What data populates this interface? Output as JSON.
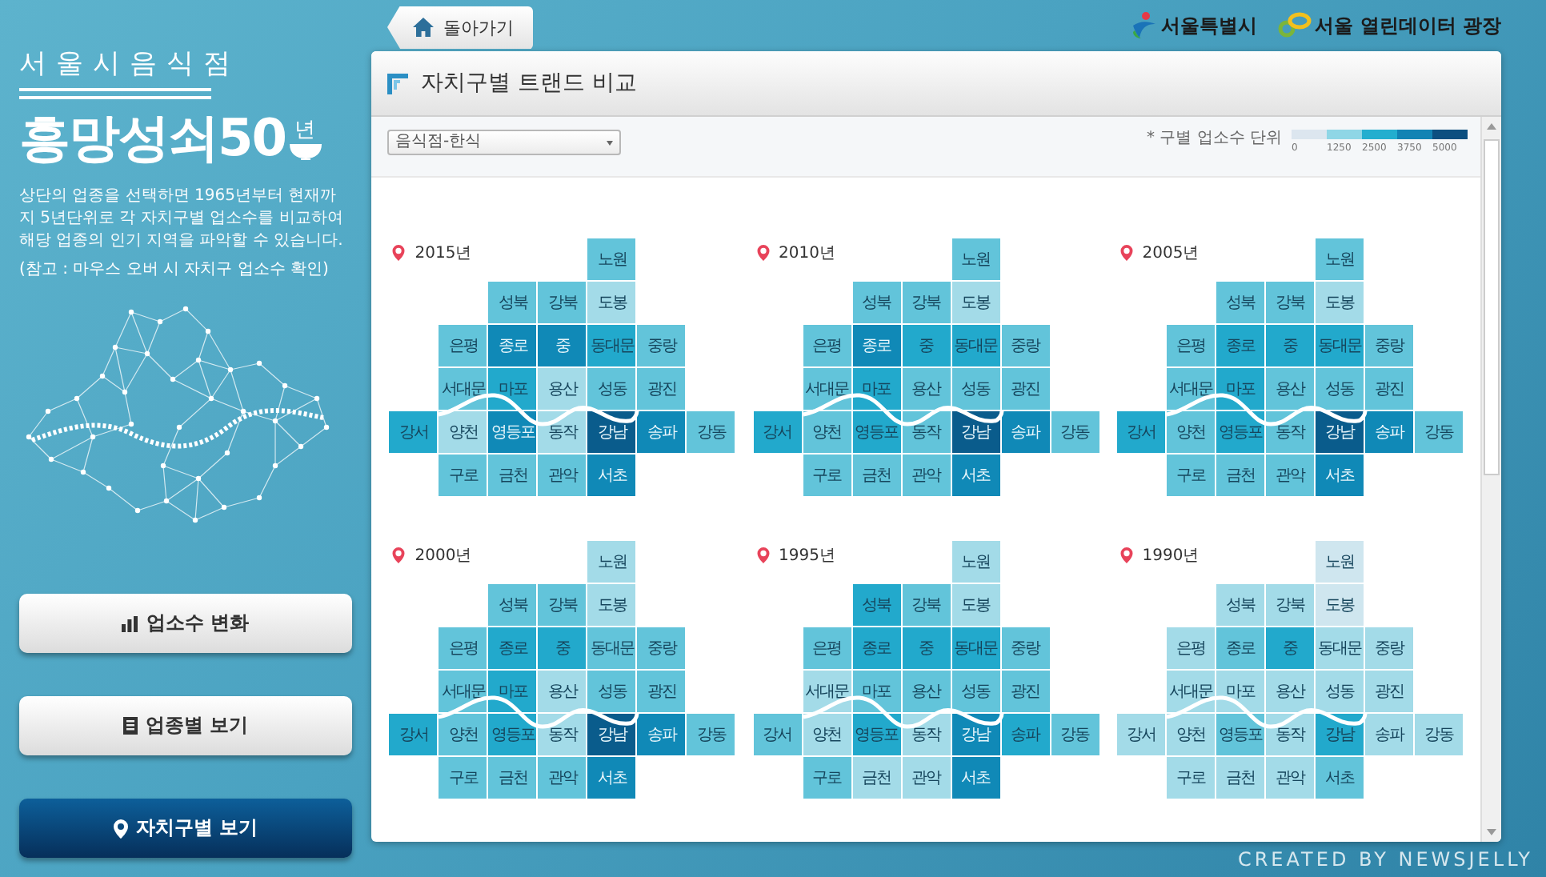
{
  "header": {
    "back_button": "돌아가기",
    "logos": [
      "서울특별시",
      "서울 열린데이터 광장"
    ]
  },
  "sidebar": {
    "subtitle": "서울시음식점",
    "title": "흥망성쇠50",
    "title_unit": "년",
    "description": "상단의 업종을 선택하면 1965년부터 현재까지 5년단위로 각 자치구별 업소수를 비교하여 해당 업종의 인기 지역을 파악할 수 있습니다.",
    "note": "(참고 : 마우스 오버 시 자치구 업소수 확인)",
    "buttons": [
      {
        "label": "업소수 변화",
        "kind": "bars",
        "selected": false
      },
      {
        "label": "업종별 보기",
        "kind": "document",
        "selected": false
      },
      {
        "label": "자치구별 보기",
        "kind": "pin",
        "selected": true
      }
    ]
  },
  "panel": {
    "title": "자치구별 트랜드 비교",
    "category_select": {
      "value": "음식점-한식"
    },
    "legend": {
      "label": "* 구별 업소수 단위",
      "swatches": [
        {
          "color": "#dce6ef"
        },
        {
          "color": "#8fd6e6"
        },
        {
          "color": "#23aecf"
        },
        {
          "color": "#1283b4"
        },
        {
          "color": "#0c4f80"
        }
      ],
      "ticks": [
        "0",
        "1250",
        "2500",
        "3750",
        "5000"
      ]
    },
    "maps": [
      {
        "year": "2015년",
        "tiles": [
          {
            "name": "노원",
            "color": "#62c4da"
          },
          {
            "name": "성북",
            "color": "#62c4da"
          },
          {
            "name": "강북",
            "color": "#62c4da"
          },
          {
            "name": "도봉",
            "color": "#a3dbe8"
          },
          {
            "name": "은평",
            "color": "#62c4da"
          },
          {
            "name": "종로",
            "color": "#1089b7"
          },
          {
            "name": "중",
            "color": "#1089b7"
          },
          {
            "name": "동대문",
            "color": "#22a9cc"
          },
          {
            "name": "중랑",
            "color": "#62c4da"
          },
          {
            "name": "서대문",
            "color": "#62c4da"
          },
          {
            "name": "마포",
            "color": "#22a9cc"
          },
          {
            "name": "용산",
            "color": "#a3dbe8"
          },
          {
            "name": "성동",
            "color": "#62c4da"
          },
          {
            "name": "광진",
            "color": "#62c4da"
          },
          {
            "name": "강서",
            "color": "#22a9cc"
          },
          {
            "name": "양천",
            "color": "#a3dbe8"
          },
          {
            "name": "영등포",
            "color": "#1089b7"
          },
          {
            "name": "동작",
            "color": "#a3dbe8"
          },
          {
            "name": "강남",
            "color": "#0a5c8c"
          },
          {
            "name": "송파",
            "color": "#1089b7"
          },
          {
            "name": "강동",
            "color": "#62c4da"
          },
          {
            "name": "구로",
            "color": "#62c4da"
          },
          {
            "name": "금천",
            "color": "#62c4da"
          },
          {
            "name": "관악",
            "color": "#62c4da"
          },
          {
            "name": "서초",
            "color": "#1089b7"
          }
        ]
      },
      {
        "year": "2010년",
        "tiles": [
          {
            "name": "노원",
            "color": "#62c4da"
          },
          {
            "name": "성북",
            "color": "#62c4da"
          },
          {
            "name": "강북",
            "color": "#62c4da"
          },
          {
            "name": "도봉",
            "color": "#a3dbe8"
          },
          {
            "name": "은평",
            "color": "#62c4da"
          },
          {
            "name": "종로",
            "color": "#1089b7"
          },
          {
            "name": "중",
            "color": "#22a9cc"
          },
          {
            "name": "동대문",
            "color": "#22a9cc"
          },
          {
            "name": "중랑",
            "color": "#62c4da"
          },
          {
            "name": "서대문",
            "color": "#62c4da"
          },
          {
            "name": "마포",
            "color": "#22a9cc"
          },
          {
            "name": "용산",
            "color": "#62c4da"
          },
          {
            "name": "성동",
            "color": "#62c4da"
          },
          {
            "name": "광진",
            "color": "#62c4da"
          },
          {
            "name": "강서",
            "color": "#22a9cc"
          },
          {
            "name": "양천",
            "color": "#62c4da"
          },
          {
            "name": "영등포",
            "color": "#22a9cc"
          },
          {
            "name": "동작",
            "color": "#62c4da"
          },
          {
            "name": "강남",
            "color": "#0a5c8c"
          },
          {
            "name": "송파",
            "color": "#1089b7"
          },
          {
            "name": "강동",
            "color": "#62c4da"
          },
          {
            "name": "구로",
            "color": "#62c4da"
          },
          {
            "name": "금천",
            "color": "#62c4da"
          },
          {
            "name": "관악",
            "color": "#62c4da"
          },
          {
            "name": "서초",
            "color": "#1089b7"
          }
        ]
      },
      {
        "year": "2005년",
        "tiles": [
          {
            "name": "노원",
            "color": "#62c4da"
          },
          {
            "name": "성북",
            "color": "#62c4da"
          },
          {
            "name": "강북",
            "color": "#62c4da"
          },
          {
            "name": "도봉",
            "color": "#a3dbe8"
          },
          {
            "name": "은평",
            "color": "#62c4da"
          },
          {
            "name": "종로",
            "color": "#22a9cc"
          },
          {
            "name": "중",
            "color": "#22a9cc"
          },
          {
            "name": "동대문",
            "color": "#22a9cc"
          },
          {
            "name": "중랑",
            "color": "#62c4da"
          },
          {
            "name": "서대문",
            "color": "#62c4da"
          },
          {
            "name": "마포",
            "color": "#22a9cc"
          },
          {
            "name": "용산",
            "color": "#62c4da"
          },
          {
            "name": "성동",
            "color": "#62c4da"
          },
          {
            "name": "광진",
            "color": "#62c4da"
          },
          {
            "name": "강서",
            "color": "#22a9cc"
          },
          {
            "name": "양천",
            "color": "#62c4da"
          },
          {
            "name": "영등포",
            "color": "#22a9cc"
          },
          {
            "name": "동작",
            "color": "#62c4da"
          },
          {
            "name": "강남",
            "color": "#0a5c8c"
          },
          {
            "name": "송파",
            "color": "#1089b7"
          },
          {
            "name": "강동",
            "color": "#62c4da"
          },
          {
            "name": "구로",
            "color": "#62c4da"
          },
          {
            "name": "금천",
            "color": "#62c4da"
          },
          {
            "name": "관악",
            "color": "#62c4da"
          },
          {
            "name": "서초",
            "color": "#1089b7"
          }
        ]
      },
      {
        "year": "2000년",
        "tiles": [
          {
            "name": "노원",
            "color": "#a3dbe8"
          },
          {
            "name": "성북",
            "color": "#62c4da"
          },
          {
            "name": "강북",
            "color": "#62c4da"
          },
          {
            "name": "도봉",
            "color": "#a3dbe8"
          },
          {
            "name": "은평",
            "color": "#62c4da"
          },
          {
            "name": "종로",
            "color": "#22a9cc"
          },
          {
            "name": "중",
            "color": "#22a9cc"
          },
          {
            "name": "동대문",
            "color": "#62c4da"
          },
          {
            "name": "중랑",
            "color": "#62c4da"
          },
          {
            "name": "서대문",
            "color": "#62c4da"
          },
          {
            "name": "마포",
            "color": "#22a9cc"
          },
          {
            "name": "용산",
            "color": "#a3dbe8"
          },
          {
            "name": "성동",
            "color": "#62c4da"
          },
          {
            "name": "광진",
            "color": "#62c4da"
          },
          {
            "name": "강서",
            "color": "#22a9cc"
          },
          {
            "name": "양천",
            "color": "#62c4da"
          },
          {
            "name": "영등포",
            "color": "#22a9cc"
          },
          {
            "name": "동작",
            "color": "#a3dbe8"
          },
          {
            "name": "강남",
            "color": "#0a5c8c"
          },
          {
            "name": "송파",
            "color": "#1089b7"
          },
          {
            "name": "강동",
            "color": "#62c4da"
          },
          {
            "name": "구로",
            "color": "#62c4da"
          },
          {
            "name": "금천",
            "color": "#62c4da"
          },
          {
            "name": "관악",
            "color": "#62c4da"
          },
          {
            "name": "서초",
            "color": "#1089b7"
          }
        ]
      },
      {
        "year": "1995년",
        "tiles": [
          {
            "name": "노원",
            "color": "#a3dbe8"
          },
          {
            "name": "성북",
            "color": "#22a9cc"
          },
          {
            "name": "강북",
            "color": "#62c4da"
          },
          {
            "name": "도봉",
            "color": "#a3dbe8"
          },
          {
            "name": "은평",
            "color": "#62c4da"
          },
          {
            "name": "종로",
            "color": "#22a9cc"
          },
          {
            "name": "중",
            "color": "#22a9cc"
          },
          {
            "name": "동대문",
            "color": "#22a9cc"
          },
          {
            "name": "중랑",
            "color": "#62c4da"
          },
          {
            "name": "서대문",
            "color": "#a3dbe8"
          },
          {
            "name": "마포",
            "color": "#62c4da"
          },
          {
            "name": "용산",
            "color": "#62c4da"
          },
          {
            "name": "성동",
            "color": "#62c4da"
          },
          {
            "name": "광진",
            "color": "#62c4da"
          },
          {
            "name": "강서",
            "color": "#62c4da"
          },
          {
            "name": "양천",
            "color": "#a3dbe8"
          },
          {
            "name": "영등포",
            "color": "#22a9cc"
          },
          {
            "name": "동작",
            "color": "#a3dbe8"
          },
          {
            "name": "강남",
            "color": "#1089b7"
          },
          {
            "name": "송파",
            "color": "#22a9cc"
          },
          {
            "name": "강동",
            "color": "#62c4da"
          },
          {
            "name": "구로",
            "color": "#62c4da"
          },
          {
            "name": "금천",
            "color": "#a3dbe8"
          },
          {
            "name": "관악",
            "color": "#a3dbe8"
          },
          {
            "name": "서초",
            "color": "#1089b7"
          }
        ]
      },
      {
        "year": "1990년",
        "tiles": [
          {
            "name": "노원",
            "color": "#cfe6ef"
          },
          {
            "name": "성북",
            "color": "#a3dbe8"
          },
          {
            "name": "강북",
            "color": "#a3dbe8"
          },
          {
            "name": "도봉",
            "color": "#cfe6ef"
          },
          {
            "name": "은평",
            "color": "#a3dbe8"
          },
          {
            "name": "종로",
            "color": "#62c4da"
          },
          {
            "name": "중",
            "color": "#22a9cc"
          },
          {
            "name": "동대문",
            "color": "#a3dbe8"
          },
          {
            "name": "중랑",
            "color": "#a3dbe8"
          },
          {
            "name": "서대문",
            "color": "#a3dbe8"
          },
          {
            "name": "마포",
            "color": "#a3dbe8"
          },
          {
            "name": "용산",
            "color": "#a3dbe8"
          },
          {
            "name": "성동",
            "color": "#a3dbe8"
          },
          {
            "name": "광진",
            "color": "#a3dbe8"
          },
          {
            "name": "강서",
            "color": "#a3dbe8"
          },
          {
            "name": "양천",
            "color": "#a3dbe8"
          },
          {
            "name": "영등포",
            "color": "#62c4da"
          },
          {
            "name": "동작",
            "color": "#a3dbe8"
          },
          {
            "name": "강남",
            "color": "#22a9cc"
          },
          {
            "name": "송파",
            "color": "#a3dbe8"
          },
          {
            "name": "강동",
            "color": "#a3dbe8"
          },
          {
            "name": "구로",
            "color": "#a3dbe8"
          },
          {
            "name": "금천",
            "color": "#a3dbe8"
          },
          {
            "name": "관악",
            "color": "#a3dbe8"
          },
          {
            "name": "서초",
            "color": "#62c4da"
          }
        ]
      }
    ]
  },
  "footer": "CREATED BY NEWSJELLY"
}
